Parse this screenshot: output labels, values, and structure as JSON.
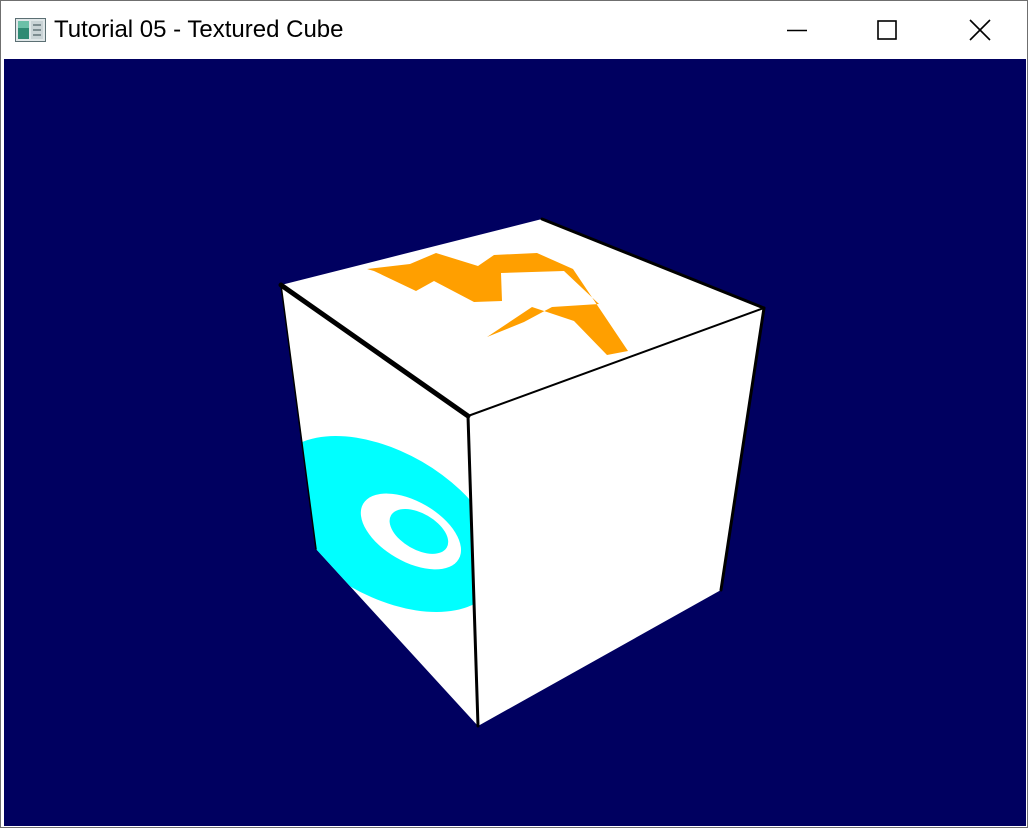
{
  "window": {
    "title": "Tutorial 05 - Textured Cube",
    "controls": {
      "minimize": "minimize-icon",
      "maximize": "maximize-icon",
      "close": "close-icon"
    }
  },
  "scene": {
    "background_color": "#000060",
    "cube_face_color": "#ffffff",
    "edge_color": "#000000",
    "top_face_glyph": {
      "text": "4",
      "color": "#ff9f00"
    },
    "left_face_glyph": {
      "text": "6",
      "color": "#00ffff"
    }
  }
}
